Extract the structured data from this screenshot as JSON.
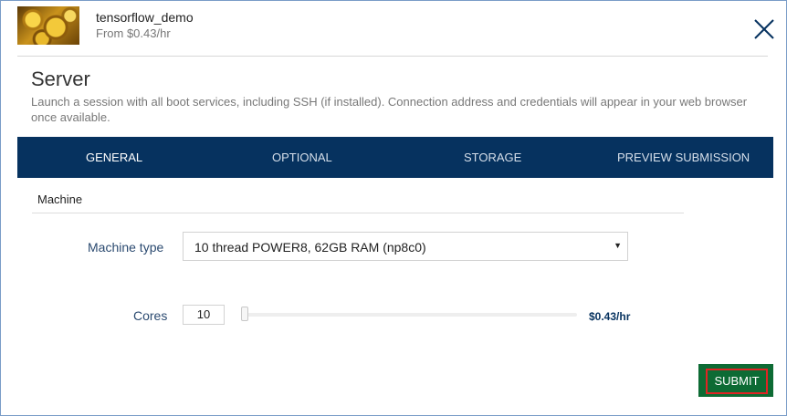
{
  "header": {
    "app_name": "tensorflow_demo",
    "app_price": "From $0.43/hr",
    "thumbnail_icon": "gold-coins-image",
    "close_icon": "close-icon"
  },
  "server": {
    "title": "Server",
    "description": "Launch a session with all boot services, including SSH (if installed). Connection address and credentials will appear in your web browser once available."
  },
  "tabs": [
    {
      "label": "GENERAL",
      "active": true
    },
    {
      "label": "OPTIONAL",
      "active": false
    },
    {
      "label": "STORAGE",
      "active": false
    },
    {
      "label": "PREVIEW SUBMISSION",
      "active": false
    }
  ],
  "machine": {
    "section_title": "Machine",
    "type_label": "Machine type",
    "type_value": "10 thread POWER8, 62GB RAM (np8c0)",
    "cores_label": "Cores",
    "cores_value": "10",
    "price": "$0.43/hr",
    "slider_level": 0
  },
  "footer": {
    "submit_label": "SUBMIT"
  },
  "colors": {
    "tab_bar": "#06325f",
    "submit": "#0d6b34",
    "submit_outline": "#e02424"
  }
}
